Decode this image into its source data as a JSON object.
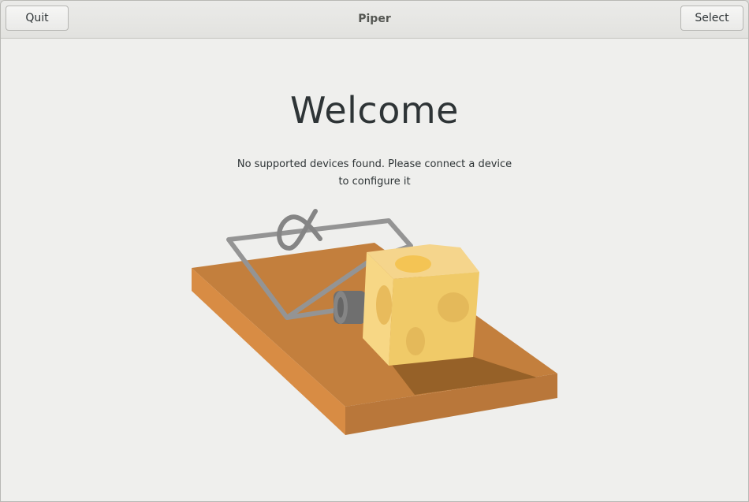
{
  "header": {
    "title": "Piper",
    "quit_label": "Quit",
    "select_label": "Select"
  },
  "welcome": {
    "heading": "Welcome",
    "message": "No supported devices found. Please connect a device to configure it"
  },
  "illustration": {
    "icon": "mousetrap-with-cheese-icon"
  },
  "colors": {
    "window_bg": "#efefed",
    "wood_top": "#c37f3d",
    "wood_side": "#d88c44",
    "wire": "#949494",
    "cheese": "#f2cd6a"
  }
}
